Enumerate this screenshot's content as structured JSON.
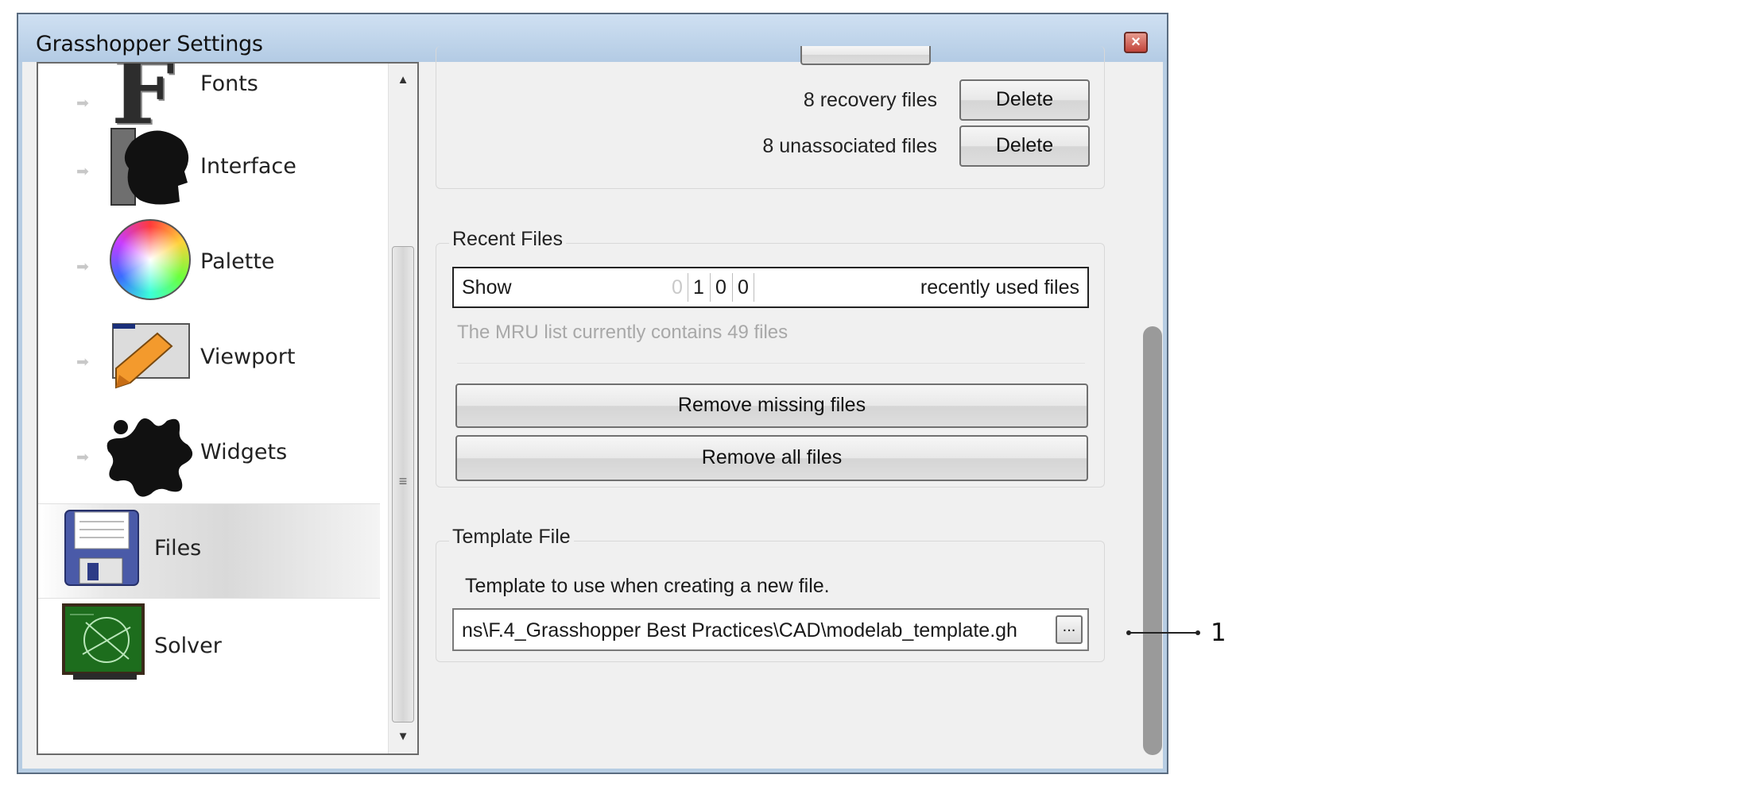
{
  "window": {
    "title": "Grasshopper Settings",
    "close_glyph": "×"
  },
  "nav": {
    "items": [
      {
        "label": "Fonts",
        "icon": "fonts-icon"
      },
      {
        "label": "Interface",
        "icon": "interface-icon"
      },
      {
        "label": "Palette",
        "icon": "palette-icon"
      },
      {
        "label": "Viewport",
        "icon": "viewport-icon"
      },
      {
        "label": "Widgets",
        "icon": "widgets-icon"
      },
      {
        "label": "Files",
        "icon": "floppy-disk-icon",
        "selected": true
      },
      {
        "label": "Solver",
        "icon": "solver-icon"
      }
    ],
    "fonts_glyph": "F",
    "arrow_glyph": "➡"
  },
  "autosave": {
    "recovery_label": "8 recovery files",
    "unassociated_label": "8 unassociated files",
    "delete_label": "Delete"
  },
  "recent_files": {
    "legend": "Recent Files",
    "show_label": "Show",
    "digits": [
      "0",
      "1",
      "0",
      "0"
    ],
    "tail_label": "recently used files",
    "info": "The MRU list currently contains 49 files",
    "remove_missing_label": "Remove missing files",
    "remove_all_label": "Remove all files"
  },
  "template_file": {
    "legend": "Template File",
    "description": "Template to use when creating a new file.",
    "path_value": "ns\\F.4_Grasshopper Best Practices\\CAD\\modelab_template.gh",
    "browse_label": "..."
  },
  "annotation": {
    "number": "1"
  },
  "colors": {
    "window_frame": "#b7cde3",
    "client_bg": "#f0f0f0",
    "close_red": "#c2443a"
  }
}
